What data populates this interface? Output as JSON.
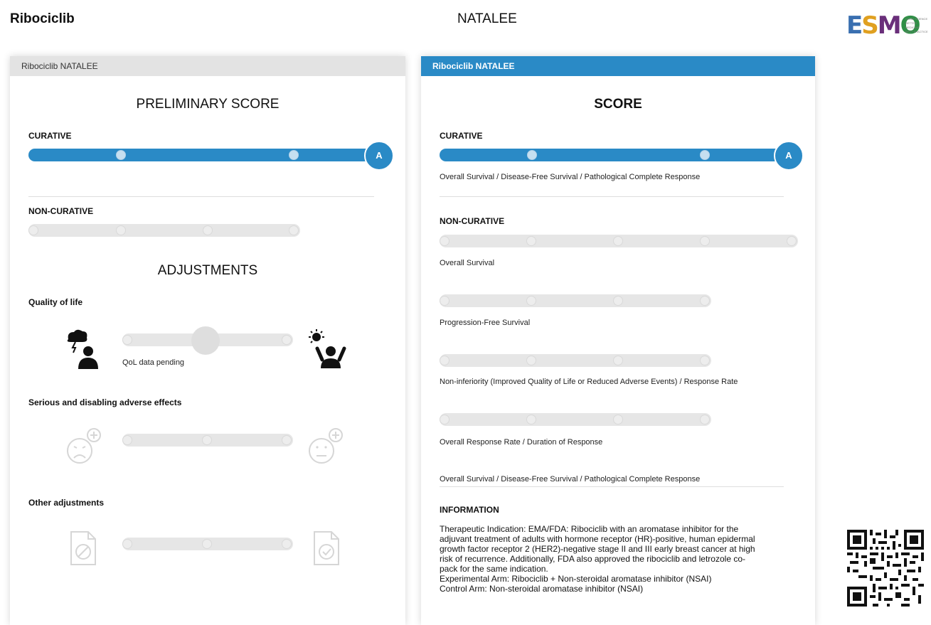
{
  "header": {
    "drug": "Ribociclib",
    "trial": "NATALEE",
    "logo": {
      "text": "ESMO",
      "tagline": [
        "GOOD SCIENCE",
        "BETTER MEDICINE",
        "BEST PRACTICE"
      ]
    }
  },
  "colors": {
    "accent": "#2a8ac6",
    "track": "#e6e6e6",
    "panel_header_gray": "#e3e3e3"
  },
  "left_panel": {
    "header": "Ribociclib NATALEE",
    "title": "PRELIMINARY SCORE",
    "curative": {
      "label": "CURATIVE",
      "grade": "A"
    },
    "non_curative": {
      "label": "NON-CURATIVE"
    },
    "adjustments": {
      "title": "ADJUSTMENTS",
      "qol": {
        "label": "Quality of life",
        "status": "QoL data pending",
        "icons": [
          "storm-person-icon",
          "sunny-person-icon"
        ]
      },
      "adverse": {
        "label": "Serious and disabling adverse effects",
        "icons": [
          "sad-face-plus-icon",
          "neutral-face-plus-icon"
        ]
      },
      "other": {
        "label": "Other adjustments",
        "icons": [
          "document-blocked-icon",
          "document-check-icon"
        ]
      }
    }
  },
  "right_panel": {
    "header": "Ribociclib NATALEE",
    "title": "SCORE",
    "curative": {
      "label": "CURATIVE",
      "grade": "A",
      "caption": "Overall Survival / Disease-Free Survival / Pathological Complete Response"
    },
    "non_curative": {
      "label": "NON-CURATIVE",
      "captions": [
        "Overall Survival",
        "Progression-Free Survival",
        "Non-inferiority (Improved Quality of Life or Reduced Adverse Events) / Response Rate",
        "Overall Response Rate / Duration of Response",
        "Overall Survival / Disease-Free Survival / Pathological Complete Response"
      ]
    },
    "information": {
      "label": "INFORMATION",
      "lines": [
        "Therapeutic Indication: EMA/FDA: Ribociclib with an aromatase inhibitor for the",
        "adjuvant treatment of adults with hormone receptor (HR)-positive, human epidermal",
        "growth factor receptor 2 (HER2)-negative stage II and III early breast cancer at high",
        "risk of recurrence. Additionally, FDA also approved the ribociclib and letrozole co-",
        "pack for the same indication.",
        "Experimental Arm: Ribociclib + Non-steroidal aromatase inhibitor (NSAI)",
        "Control Arm: Non-steroidal aromatase inhibitor (NSAI)"
      ]
    }
  },
  "qr": {
    "icon": "qr-code-icon"
  }
}
